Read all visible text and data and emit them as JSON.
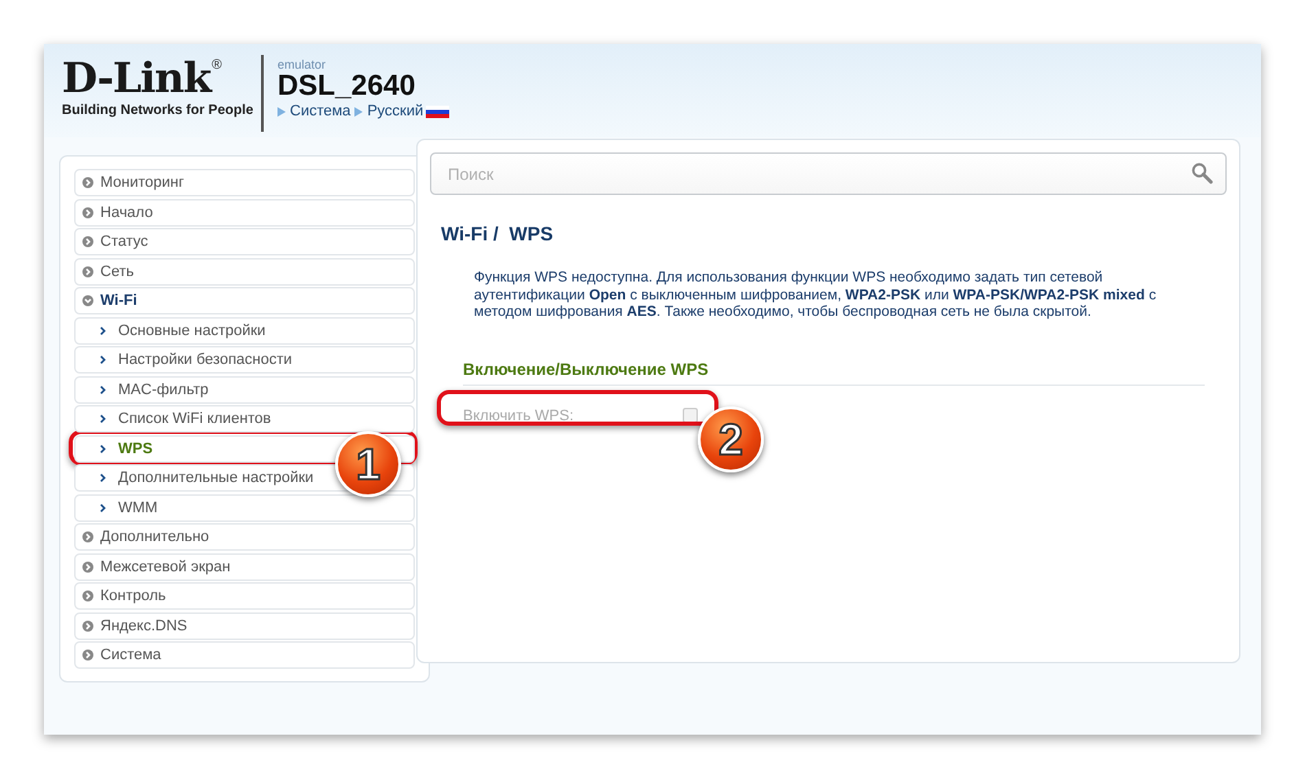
{
  "header": {
    "logo": {
      "brand": "D-Link",
      "registered": "®",
      "tagline": "Building Networks for People"
    },
    "subtitle": "emulator",
    "model": "DSL_2640",
    "links": [
      {
        "label": "Система",
        "flag": false
      },
      {
        "label": "Русский",
        "flag": true
      }
    ]
  },
  "sidebar": {
    "items": [
      {
        "label": "Мониторинг",
        "expanded": false,
        "selected": false
      },
      {
        "label": "Начало",
        "expanded": false,
        "selected": false
      },
      {
        "label": "Статус",
        "expanded": false,
        "selected": false
      },
      {
        "label": "Сеть",
        "expanded": false,
        "selected": false
      },
      {
        "label": "Wi-Fi",
        "expanded": true,
        "selected": false,
        "children": [
          {
            "label": "Основные настройки",
            "selected": false
          },
          {
            "label": "Настройки безопасности",
            "selected": false
          },
          {
            "label": "MAC-фильтр",
            "selected": false
          },
          {
            "label": "Список WiFi клиентов",
            "selected": false
          },
          {
            "label": "WPS",
            "selected": true
          },
          {
            "label": "Дополнительные настройки",
            "selected": false
          },
          {
            "label": "WMM",
            "selected": false
          }
        ]
      },
      {
        "label": "Дополнительно",
        "expanded": false,
        "selected": false
      },
      {
        "label": "Межсетевой экран",
        "expanded": false,
        "selected": false
      },
      {
        "label": "Контроль",
        "expanded": false,
        "selected": false
      },
      {
        "label": "Яндекс.DNS",
        "expanded": false,
        "selected": false
      },
      {
        "label": "Система",
        "expanded": false,
        "selected": false
      }
    ]
  },
  "content": {
    "search": {
      "placeholder": "Поиск"
    },
    "title": "Wi-Fi /  WPS",
    "notice": "Функция WPS недоступна. Для использования функции WPS необходимо задать тип сетевой аутентификации **Open** с выключенным шифрованием, **WPA2-PSK** или **WPA-PSK/WPA2-PSK mixed** с методом шифрования **AES**. Также необходимо, чтобы беспроводная сеть не была скрытой.",
    "section": {
      "title": "Включение/Выключение WPS",
      "fields": [
        {
          "label": "Включить WPS:",
          "checked": false,
          "disabled": true
        }
      ]
    }
  },
  "annotations": [
    {
      "number": "1"
    },
    {
      "number": "2"
    }
  ]
}
